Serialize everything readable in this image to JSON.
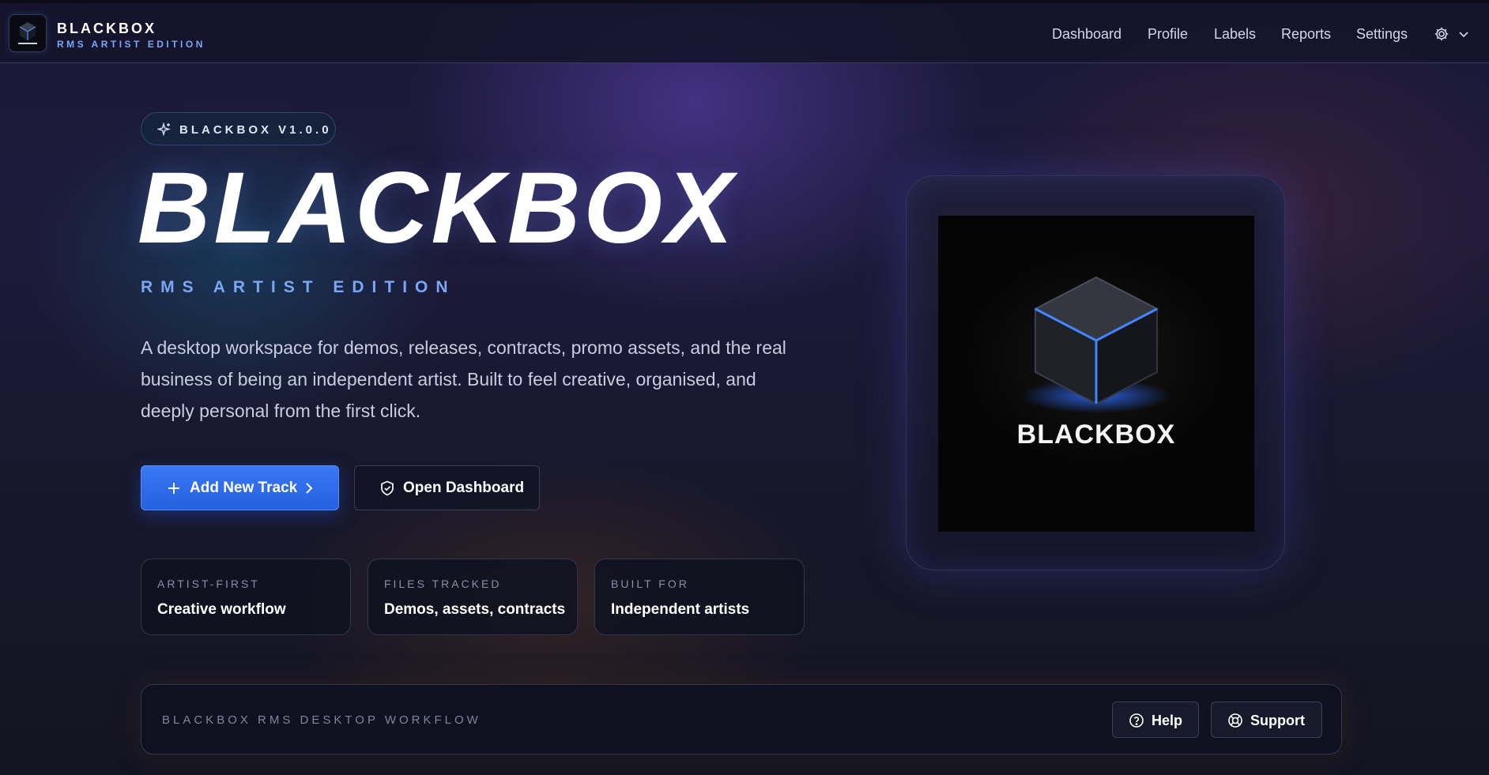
{
  "app": {
    "brand_title": "BLACKBOX",
    "brand_subtitle": "RMS ARTIST EDITION",
    "logo_icon": "blackbox-cube-logo"
  },
  "nav": {
    "items": [
      "Dashboard",
      "Profile",
      "Labels",
      "Reports",
      "Settings"
    ],
    "settings_icon": "gear-icon",
    "menu_icon": "chevron-down-icon"
  },
  "hero": {
    "version_label": "BLACKBOX V1.0.0",
    "title": "BLACKBOX",
    "subtitle": "RMS ARTIST EDITION",
    "description": "A desktop workspace for demos, releases, contracts, promo assets, and the real business of being an independent artist. Built to feel creative, organised, and deeply personal from the first click.",
    "primary_button": "Add New Track",
    "secondary_button": "Open Dashboard"
  },
  "stats": [
    {
      "label": "ARTIST-FIRST",
      "value": "Creative workflow"
    },
    {
      "label": "FILES TRACKED",
      "value": "Demos, assets, contracts"
    },
    {
      "label": "BUILT FOR",
      "value": "Independent artists"
    }
  ],
  "showcase": {
    "brand_text": "BLACKBOX"
  },
  "footer": {
    "text": "BLACKBOX RMS DESKTOP WORKFLOW",
    "help_button": "Help",
    "support_button": "Support"
  },
  "colors": {
    "accent": "#3a78f5",
    "accent_text": "#7aa6f5",
    "background": "#161527"
  }
}
